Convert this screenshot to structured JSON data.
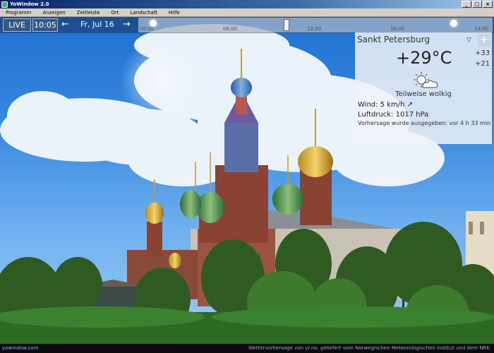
{
  "window": {
    "title": "YoWindow 2.0"
  },
  "menu": [
    "Programm",
    "Anzeigen",
    "Zeitleiste",
    "Ort",
    "Landschaft",
    "Hilfe"
  ],
  "controls": {
    "live_label": "LIVE",
    "time": "10:05",
    "back_arrow": "←",
    "forward_arrow": "→",
    "date": "Fr, Jul 16"
  },
  "timeline": {
    "ticks": [
      "00:00",
      "06:00",
      "12:00",
      "18:00",
      "24:00"
    ]
  },
  "weather": {
    "city": "Sankt Petersburg",
    "dropdown_glyph": "▽",
    "add_glyph": "+",
    "temperature": "+29°C",
    "high": "+33",
    "low": "+21",
    "condition": "Teilweise wolkig",
    "wind": "Wind:  5 km/h  ↗",
    "pressure": "Luftdruck:  1017 hPa",
    "forecast_issued": "Vorhersage wurde ausgegeben:  vor 4 h 33 min",
    "icon": "partly-cloudy-icon"
  },
  "status": {
    "site": "yowindow.com",
    "credit": "Wettervorhersage von yr.no, geliefert vom Norwegischen Meteorologischen Institut und dem NRK"
  }
}
